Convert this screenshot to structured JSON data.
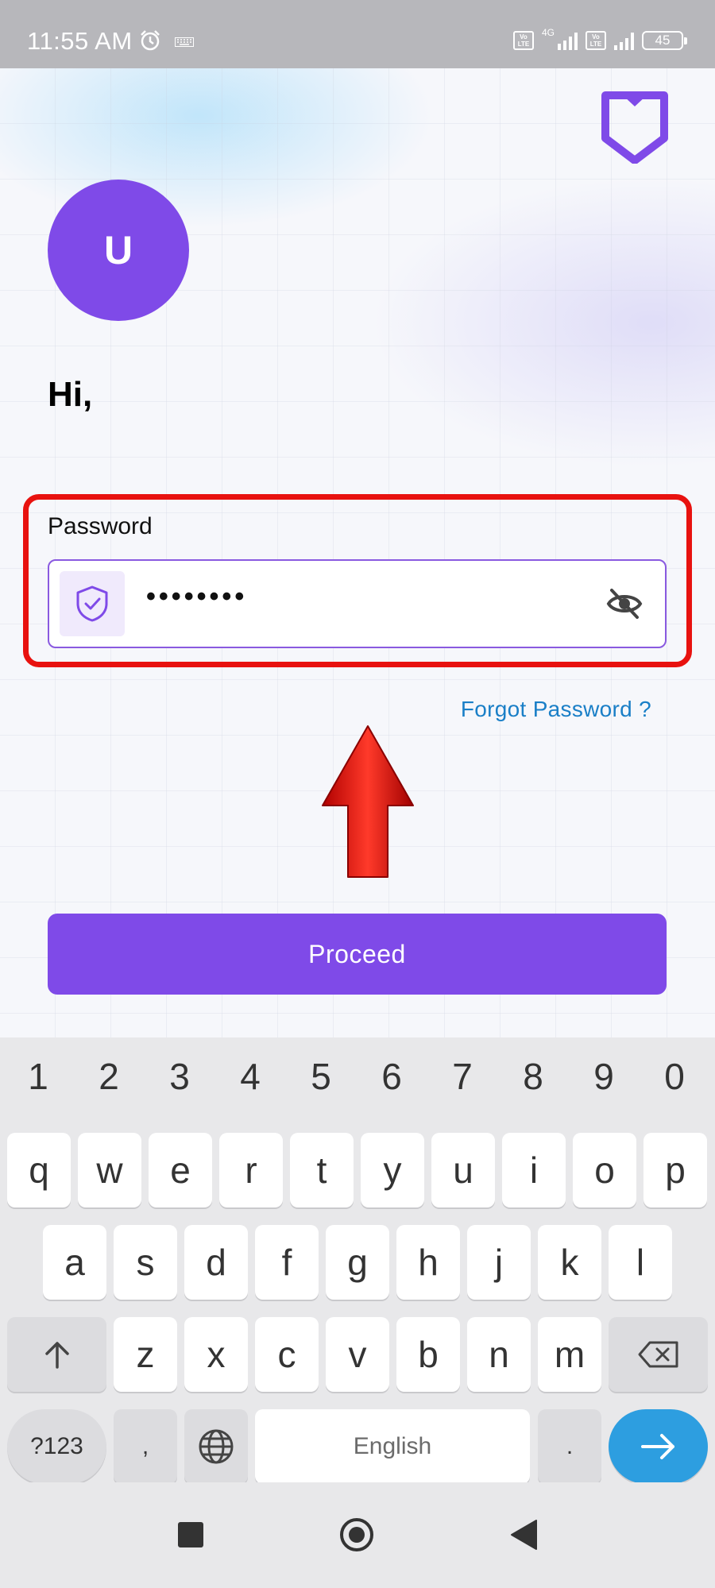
{
  "status_bar": {
    "time": "11:55 AM",
    "network_type": "4G",
    "sim1_badge": "Vo LTE",
    "sim2_badge": "Vo LTE",
    "battery": "45"
  },
  "app": {
    "avatar_initial": "U",
    "greeting": "Hi,",
    "password": {
      "label": "Password",
      "masked_value": "••••••••",
      "leading_icon": "shield-check-icon",
      "trailing_icon": "eye-off-icon"
    },
    "forgot_link": "Forgot Password ?",
    "proceed_label": "Proceed",
    "accent_color": "#7f4ae8",
    "highlight_color": "#e8120f"
  },
  "keyboard": {
    "number_row": [
      "1",
      "2",
      "3",
      "4",
      "5",
      "6",
      "7",
      "8",
      "9",
      "0"
    ],
    "row1": [
      "q",
      "w",
      "e",
      "r",
      "t",
      "y",
      "u",
      "i",
      "o",
      "p"
    ],
    "row2": [
      "a",
      "s",
      "d",
      "f",
      "g",
      "h",
      "j",
      "k",
      "l"
    ],
    "row3": [
      "z",
      "x",
      "c",
      "v",
      "b",
      "n",
      "m"
    ],
    "symbols_key": "?123",
    "comma_key": ",",
    "space_label": "English",
    "period_key": "."
  },
  "nav_bar": {
    "icons": [
      "recents-square-icon",
      "home-circle-icon",
      "back-triangle-icon"
    ]
  }
}
